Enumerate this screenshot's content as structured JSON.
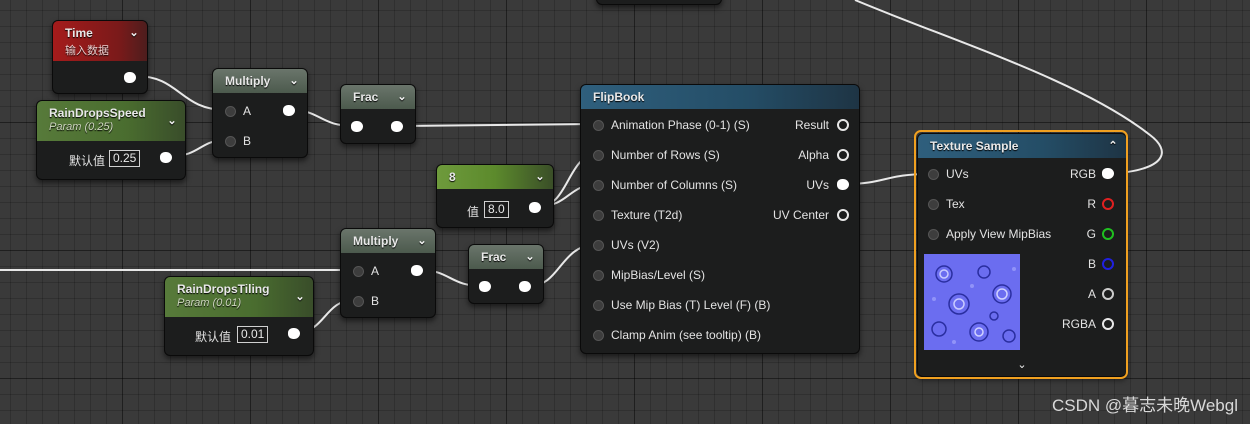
{
  "nodes": {
    "time": {
      "title": "Time",
      "subtitle": "输入数据"
    },
    "rain_speed": {
      "title": "RainDropsSpeed",
      "subtitle": "Param (0.25)",
      "default_label": "默认值",
      "value": "0.25"
    },
    "multiply_top": {
      "title": "Multiply",
      "pin_a": "A",
      "pin_b": "B"
    },
    "frac_top": {
      "title": "Frac"
    },
    "const_8": {
      "title": "8",
      "value_label": "值",
      "value": "8.0"
    },
    "multiply_bottom": {
      "title": "Multiply",
      "pin_a": "A",
      "pin_b": "B"
    },
    "frac_bottom": {
      "title": "Frac"
    },
    "rain_tiling": {
      "title": "RainDropsTiling",
      "subtitle": "Param (0.01)",
      "default_label": "默认值",
      "value": "0.01"
    },
    "flipbook": {
      "title": "FlipBook",
      "inputs": [
        "Animation  Phase (0-1) (S)",
        "Number of Rows (S)",
        "Number of Columns (S)",
        "Texture (T2d)",
        "UVs (V2)",
        "MipBias/Level (S)",
        "Use Mip Bias (T) Level (F) (B)",
        "Clamp Anim (see tooltip) (B)"
      ],
      "outputs": [
        "Result",
        "Alpha",
        "UVs",
        "UV Center"
      ]
    },
    "texture_sample": {
      "title": "Texture Sample",
      "inputs": [
        "UVs",
        "Tex",
        "Apply View MipBias"
      ],
      "outputs": [
        "RGB",
        "R",
        "G",
        "B",
        "A",
        "RGBA"
      ]
    }
  },
  "colors": {
    "selection": "#f0a020",
    "pin_r": "#e02020",
    "pin_g": "#20c020",
    "pin_b": "#2020e0"
  },
  "watermark": "CSDN @暮志未晚Webgl"
}
